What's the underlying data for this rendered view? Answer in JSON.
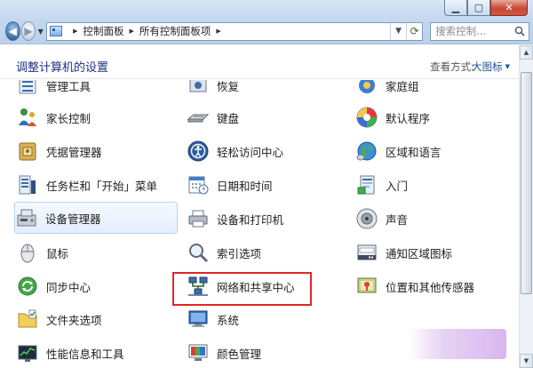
{
  "window": {
    "minimize": "▁",
    "maximize": "▢",
    "close": "✕"
  },
  "nav": {
    "back": "◀",
    "forward": "▶",
    "breadcrumb": [
      "控制面板",
      "所有控制面板项"
    ],
    "search_placeholder": "搜索控制..."
  },
  "header": {
    "title": "调整计算机的设置",
    "view_by_label": "查看方式:",
    "view_by_value": "大图标"
  },
  "items": {
    "col1": [
      "管理工具",
      "家长控制",
      "凭据管理器",
      "任务栏和「开始」菜单",
      "设备管理器",
      "鼠标",
      "同步中心",
      "文件夹选项",
      "性能信息和工具"
    ],
    "col2": [
      "恢复",
      "键盘",
      "轻松访问中心",
      "日期和时间",
      "设备和打印机",
      "索引选项",
      "网络和共享中心",
      "系统",
      "颜色管理"
    ],
    "col3": [
      "家庭组",
      "默认程序",
      "区域和语言",
      "入门",
      "声音",
      "通知区域图标",
      "位置和其他传感器"
    ]
  },
  "highlighted_item": "网络和共享中心",
  "hovered_item": "设备管理器",
  "colors": {
    "title": "#1e3287",
    "link": "#1e50a0",
    "highlight_box": "#e0262a",
    "hover_border": "#b8d6fb"
  }
}
